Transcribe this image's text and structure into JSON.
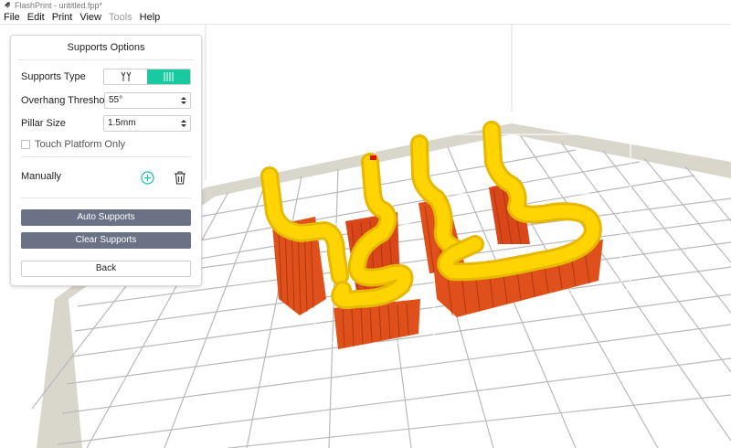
{
  "window": {
    "title": "FlashPrint - untitled.fpp*",
    "app_icon": "flashprint-logo-icon"
  },
  "menu": {
    "items": [
      {
        "label": "File",
        "enabled": true
      },
      {
        "label": "Edit",
        "enabled": true
      },
      {
        "label": "Print",
        "enabled": true
      },
      {
        "label": "View",
        "enabled": true
      },
      {
        "label": "Tools",
        "enabled": false
      },
      {
        "label": "Help",
        "enabled": true
      }
    ]
  },
  "supports_panel": {
    "title": "Supports Options",
    "supports_type": {
      "label": "Supports Type",
      "options": [
        {
          "icon": "tree-support-icon",
          "selected": false
        },
        {
          "icon": "linear-support-icon",
          "selected": true
        }
      ]
    },
    "overhang_threshold": {
      "label": "Overhang Threshold",
      "value": "55°"
    },
    "pillar_size": {
      "label": "Pillar Size",
      "value": "1.5mm"
    },
    "touch_platform_only": {
      "label": "Touch Platform Only",
      "checked": false
    },
    "manually": {
      "label": "Manually",
      "add_icon": "add-circle-icon",
      "delete_icon": "trash-icon"
    },
    "auto_supports_label": "Auto Supports",
    "clear_supports_label": "Clear Supports",
    "back_label": "Back"
  },
  "colors": {
    "accent": "#19c9a0",
    "dark_button": "#6c7286",
    "model": "#ffd400",
    "support": "#e0501a",
    "grid": "#b9b9b9",
    "platform_frame": "#d9d6cc"
  }
}
